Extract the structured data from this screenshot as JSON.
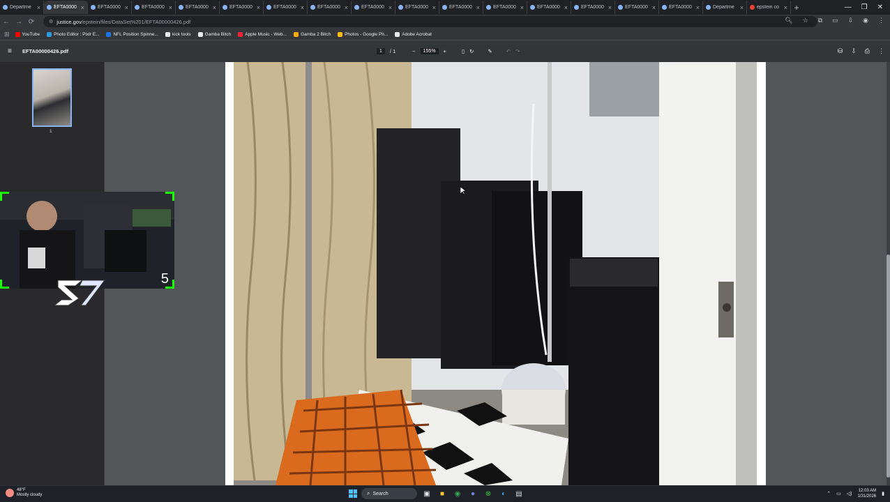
{
  "tabs": [
    {
      "label": "Departme",
      "favicon": "gov",
      "active": false
    },
    {
      "label": "EFTA0000",
      "favicon": "gov",
      "active": true
    },
    {
      "label": "EFTA0000",
      "favicon": "gov",
      "active": false
    },
    {
      "label": "EFTA0000",
      "favicon": "gov",
      "active": false
    },
    {
      "label": "EFTA0000",
      "favicon": "gov",
      "active": false
    },
    {
      "label": "EFTA0000",
      "favicon": "gov",
      "active": false
    },
    {
      "label": "EFTA0000",
      "favicon": "gov",
      "active": false
    },
    {
      "label": "EFTA0000",
      "favicon": "gov",
      "active": false
    },
    {
      "label": "EFTA0000",
      "favicon": "gov",
      "active": false
    },
    {
      "label": "EFTA0000",
      "favicon": "gov",
      "active": false
    },
    {
      "label": "EFTA0000",
      "favicon": "gov",
      "active": false
    },
    {
      "label": "EFTA0000",
      "favicon": "gov",
      "active": false
    },
    {
      "label": "EFTA0000",
      "favicon": "gov",
      "active": false
    },
    {
      "label": "EFTA0000",
      "favicon": "gov",
      "active": false
    },
    {
      "label": "EFTA0000",
      "favicon": "gov",
      "active": false
    },
    {
      "label": "EFTA0000",
      "favicon": "gov",
      "active": false
    },
    {
      "label": "Departme",
      "favicon": "gov",
      "active": false
    },
    {
      "label": "epstein co",
      "favicon": "chrome",
      "active": false
    }
  ],
  "newtab_label": "+",
  "window_controls": {
    "minimize": "—",
    "maximize": "❐",
    "close": "✕"
  },
  "address": {
    "host": "justice.gov",
    "path": "/epstein/files/DataSet%201/EFTA00000426.pdf"
  },
  "bookmarks": [
    {
      "label": "YouTube",
      "color": "#ff0000"
    },
    {
      "label": "Photo Editor : Pixlr E...",
      "color": "#2d9cdb"
    },
    {
      "label": "NFL Position Spinne...",
      "color": "#1a73e8"
    },
    {
      "label": "kick tools",
      "color": "#e8eaed"
    },
    {
      "label": "Gamba Bitch",
      "color": "#e8eaed"
    },
    {
      "label": "Apple Music - Web...",
      "color": "#fa233b"
    },
    {
      "label": "Gamba 2 Bitch",
      "color": "#f9ab00"
    },
    {
      "label": "Photos - Google Ph...",
      "color": "#fbbc04"
    },
    {
      "label": "Adobe Acrobat",
      "color": "#e8eaed"
    }
  ],
  "pdf": {
    "filename": "EFTA00000426.pdf",
    "page_current": "1",
    "page_total": "/ 1",
    "zoom": "155%",
    "thumbnail_number": "1"
  },
  "webcam": {
    "counter": "5"
  },
  "taskbar": {
    "weather_temp": "48°F",
    "weather_desc": "Mostly cloudy",
    "search_placeholder": "Search",
    "time": "12:03 AM",
    "date": "1/31/2026"
  }
}
